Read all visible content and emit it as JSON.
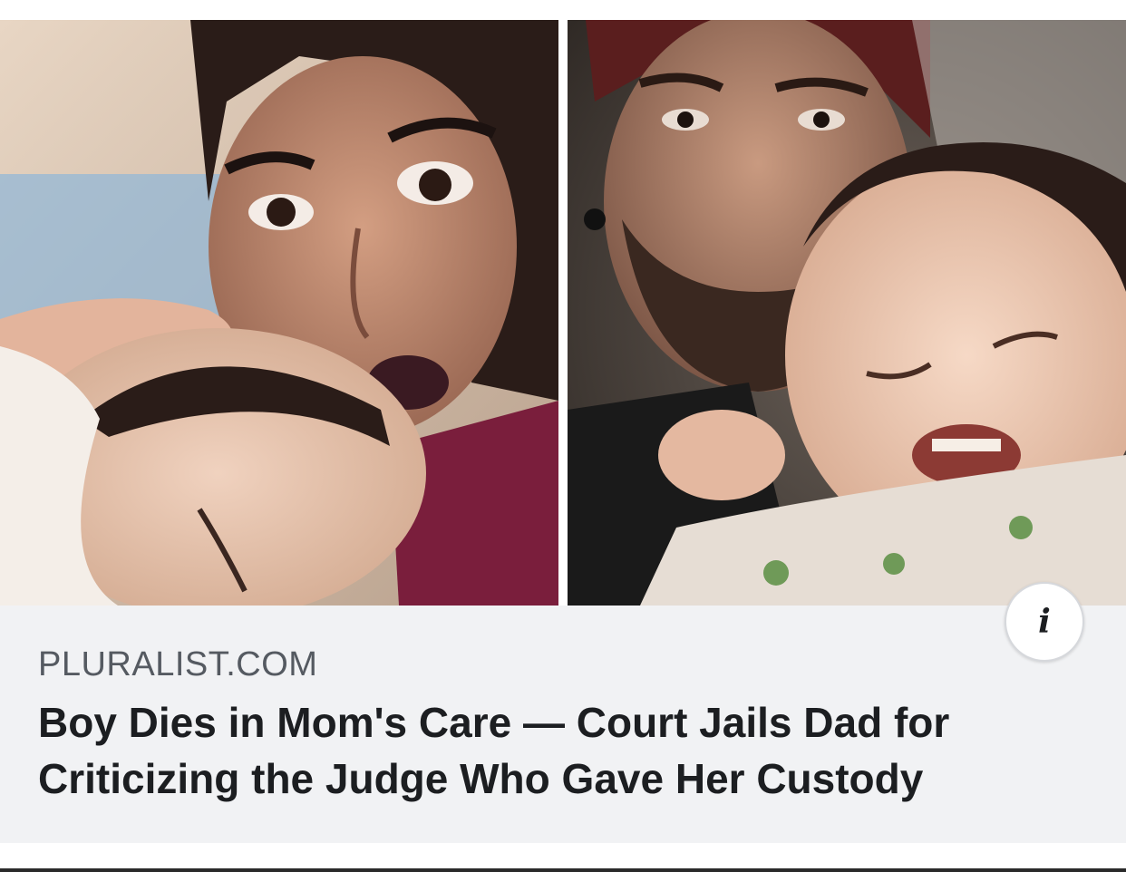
{
  "link_card": {
    "domain": "PLURALIST.COM",
    "headline": "Boy Dies in Mom's Care — Court Jails Dad for Criticizing the Judge Who Gave Her Custody",
    "info_icon_glyph": "i"
  },
  "photos": [
    {
      "icon": "photo-mother-and-baby"
    },
    {
      "icon": "photo-father-and-baby"
    }
  ]
}
